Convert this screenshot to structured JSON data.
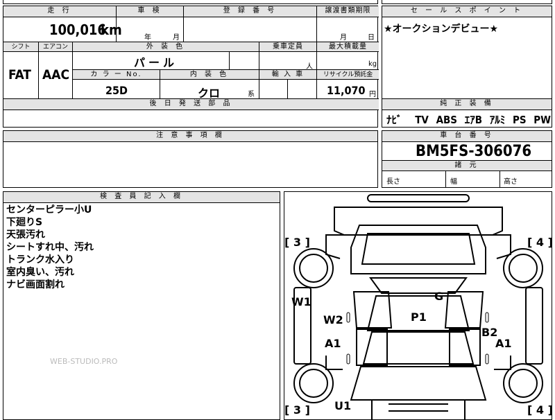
{
  "top_cut": {
    "left": "",
    "right": ""
  },
  "left_table": {
    "mileage_label": "走 行",
    "mileage_value": "100,016",
    "mileage_unit": "km",
    "inspection_label": "車 検",
    "inspection_year": "年",
    "inspection_month": "月",
    "registration_label": "登 録 番 号",
    "transfer_label": "譲渡書類期限",
    "transfer_month": "月",
    "transfer_day": "日",
    "shift_label": "シフト",
    "aircon_label": "エアコン",
    "color_label": "外 装 色",
    "capacity_label": "乗車定員",
    "maxload_label": "最大積載量",
    "shift_value": "FAT",
    "aircon_value": "AAC",
    "color_value": "パ ー ル",
    "capacity_unit": "人",
    "maxload_unit": "kg",
    "colorno_label": "カ ラ ー No.",
    "interior_label": "内 装 色",
    "import_label": "輸 入 車",
    "recycle_label": "リサイクル預託金",
    "colorno_value": "25D",
    "interior_value": "クロ",
    "interior_suffix": "系",
    "recycle_value": "11,070",
    "recycle_unit": "円",
    "parts_label": "後 日 発 送 部 品"
  },
  "sales_point": {
    "label": "セ ー ル ス ポ イ ン ト",
    "text": "★オークションデビュー★",
    "equipment_label": "純 正 装 備",
    "equipment": [
      "ﾅﾋﾞ",
      "TV",
      "ABS",
      "ｴｱB",
      "ｱﾙﾐ",
      "PS",
      "PW"
    ]
  },
  "caution": {
    "label": "注 意 事 項 欄"
  },
  "chassis": {
    "label": "車 台 番 号",
    "number": "BM5FS-306076",
    "dims_label": "諸 元",
    "length_label": "長さ",
    "width_label": "幅",
    "height_label": "高さ"
  },
  "inspector": {
    "label": "検 査 員 記 入 欄",
    "notes": [
      "センターピラー小U",
      "下廻りS",
      "天張汚れ",
      "シートすれ中、汚れ",
      "トランク水入り",
      "室内臭い、汚れ",
      "ナビ画面割れ"
    ]
  },
  "watermark": "WEB-STUDIO.PRO",
  "diagram": {
    "marks": {
      "tl": "[ 3 ]",
      "tr": "[ 4 ]",
      "bl": "[ 3 ]",
      "br": "[ 4 ]",
      "w1": "W1",
      "g": "G",
      "w2": "W2",
      "p1": "P1",
      "b2": "B2",
      "a1_left": "A1",
      "a1_right": "A1",
      "u1": "U1"
    }
  }
}
